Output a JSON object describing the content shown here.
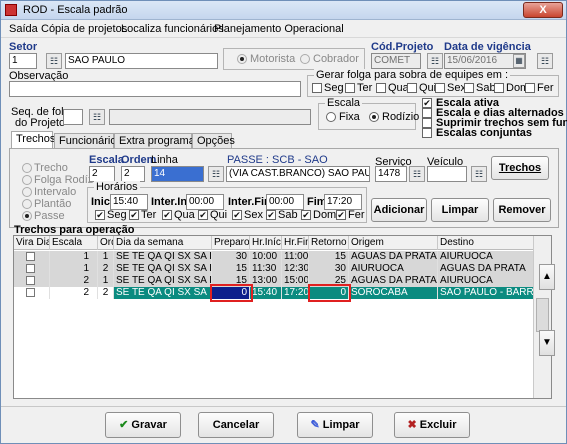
{
  "window": {
    "title": "ROD - Escala padrão",
    "close": "X"
  },
  "menu": [
    "Saída",
    "Cópia de projetos",
    "Localiza funcionários",
    "Planejamento Operacional"
  ],
  "header": {
    "setor_label": "Setor",
    "setor_code": "1",
    "setor_name": "SAO PAULO",
    "tipo_motorista": "Motorista",
    "tipo_cobrador": "Cobrador",
    "cod_projeto_label": "Cód.Projeto",
    "cod_projeto": "COMET",
    "vigencia_label": "Data de vigência",
    "vigencia": "15/06/2016",
    "observacao_label": "Observação",
    "observacao": ""
  },
  "folga": {
    "title": "Gerar folga para sobra de equipes em :",
    "days": [
      "Seg",
      "Ter",
      "Qua",
      "Qui",
      "Sex",
      "Sab",
      "Dom",
      "Fer"
    ]
  },
  "seq_folga": {
    "label_line1": "Seq. de folga",
    "label_line2": "do Projeto",
    "value": ""
  },
  "escala": {
    "title": "Escala",
    "fixa": "Fixa",
    "rodizio": "Rodízio",
    "selected": "Rodízio"
  },
  "options": [
    {
      "label": "Escala ativa",
      "checked": true
    },
    {
      "label": "Escala e dias alternados",
      "checked": false
    },
    {
      "label": "Suprimir trechos sem func.",
      "checked": false
    },
    {
      "label": "Escalas conjuntas",
      "checked": false
    }
  ],
  "tabs": [
    "Trechos",
    "Funcionários",
    "Extra programado",
    "Opções"
  ],
  "trecho_types": [
    "Trecho",
    "Folga Rodízio",
    "Intervalo",
    "Plantão",
    "Passe"
  ],
  "trecho": {
    "escala_label": "Escala",
    "escala": "2",
    "ordem_label": "Ordem",
    "ordem": "2",
    "linha_label": "Linha",
    "linha": "14",
    "passe_title": "PASSE : SCB - SAO",
    "linha_desc": "(VIA CAST.BRANCO) SAO PAULO - SOR",
    "servico_label": "Serviço",
    "servico": "1478",
    "veiculo_label": "Veículo",
    "veiculo": "",
    "trechos_button": "Trechos"
  },
  "horarios": {
    "title": "Horários",
    "inic_label": "Inic",
    "inic": "15:40",
    "inter_ini_label": "Inter.Ini",
    "inter_ini": "00:00",
    "inter_fim_label": "Inter.Fim",
    "inter_fim": "00:00",
    "fim_label": "Fim",
    "fim": "17:20",
    "days": [
      "Seg",
      "Ter",
      "Qua",
      "Qui",
      "Sex",
      "Sab",
      "Dom",
      "Fer"
    ]
  },
  "actions": {
    "adicionar": "Adicionar",
    "limpar": "Limpar",
    "remover": "Remover"
  },
  "grid": {
    "title": "Trechos para operação",
    "columns": [
      "Vira Dia",
      "Escala",
      "Ordem",
      "Dia da semana",
      "Preparo",
      "Hr.Início",
      "Hr.Fim",
      "Retorno",
      "Origem",
      "Destino"
    ],
    "rows": [
      [
        "",
        "1",
        "1",
        "SE TE QA QI SX SA DO ...",
        "30",
        "10:00",
        "11:00",
        "15",
        "AGUAS DA PRATA",
        "AIURUOCA"
      ],
      [
        "",
        "1",
        "2",
        "SE TE QA QI SX SA DO ...",
        "15",
        "11:30",
        "12:30",
        "30",
        "AIURUOCA",
        "AGUAS DA PRATA"
      ],
      [
        "",
        "2",
        "1",
        "SE TE QA QI SX SA DO ...",
        "15",
        "13:00",
        "15:00",
        "25",
        "AGUAS DA PRATA",
        "AIURUOCA"
      ],
      [
        "",
        "2",
        "2",
        "SE TE QA QI SX SA DO ...",
        "0",
        "15:40",
        "17:20",
        "0",
        "SOROCABA",
        "SAO PAULO - BARRA"
      ]
    ]
  },
  "footer": {
    "gravar": "Gravar",
    "cancelar": "Cancelar",
    "limpar": "Limpar",
    "excluir": "Excluir"
  }
}
